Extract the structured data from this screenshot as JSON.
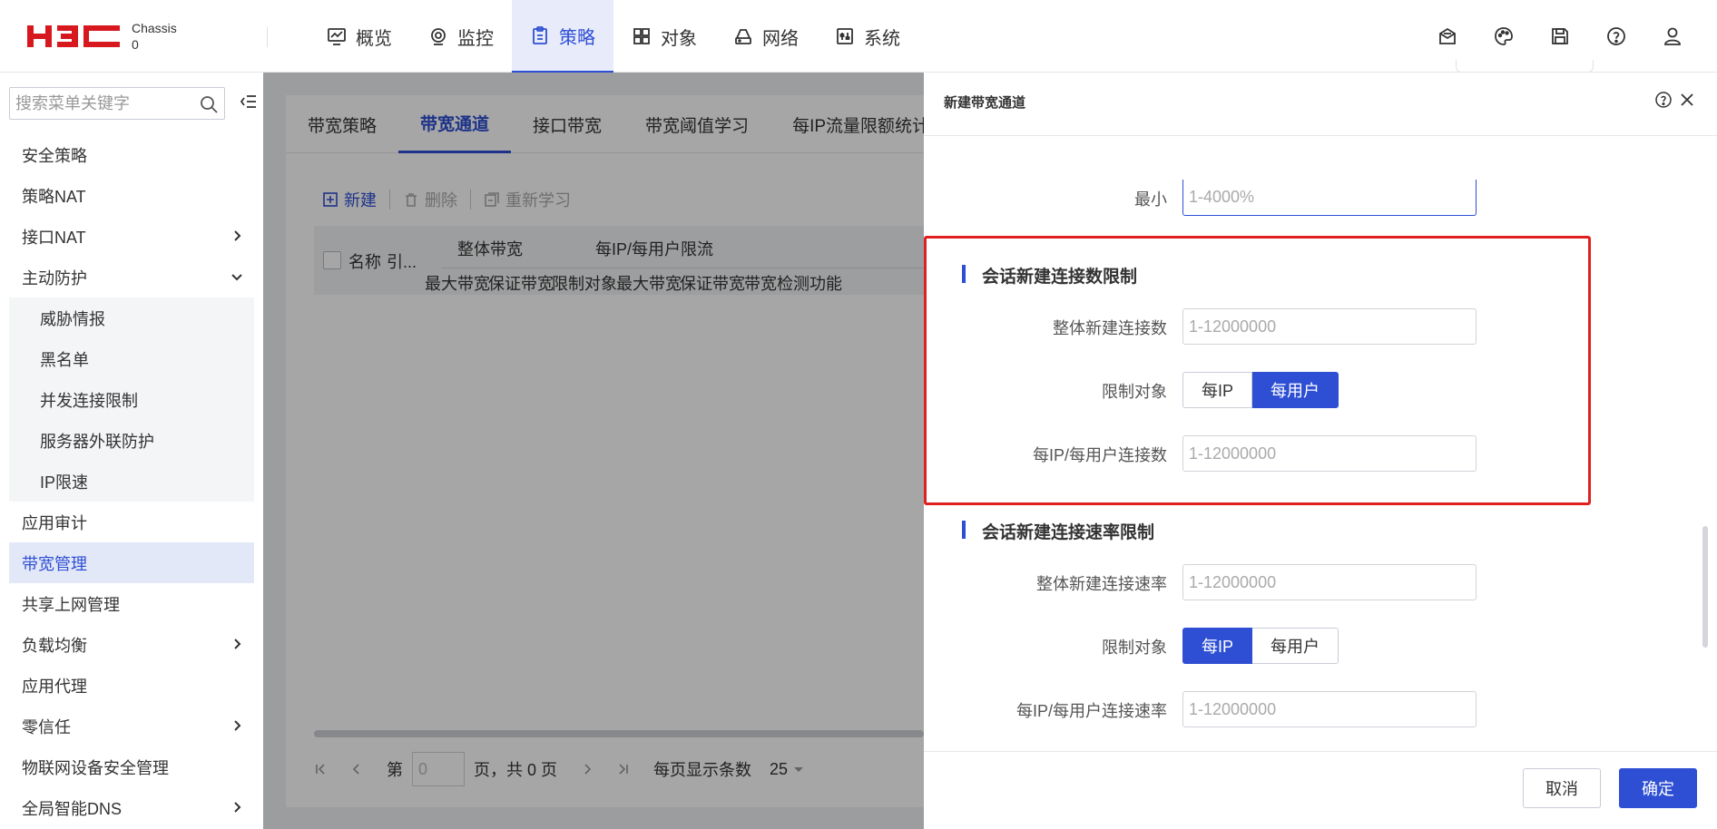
{
  "app": {
    "brand": "H3C",
    "chassis_label": "Chassis",
    "chassis_value": "0",
    "colors": {
      "accent": "#2e4fd3",
      "highlight_border": "#e02020",
      "brand_red": "#d7191f"
    }
  },
  "nav": {
    "items": [
      {
        "label": "概览",
        "icon": "dashboard-icon"
      },
      {
        "label": "监控",
        "icon": "monitor-icon"
      },
      {
        "label": "策略",
        "icon": "policy-icon",
        "active": true
      },
      {
        "label": "对象",
        "icon": "object-grid-icon"
      },
      {
        "label": "网络",
        "icon": "network-icon"
      },
      {
        "label": "系统",
        "icon": "system-icon"
      }
    ],
    "right_icons": [
      "message-icon",
      "palette-icon",
      "save-icon",
      "help-icon",
      "user-icon"
    ]
  },
  "sidebar": {
    "search_placeholder": "搜索菜单关键字",
    "items": [
      {
        "label": "安全策略"
      },
      {
        "label": "策略NAT"
      },
      {
        "label": "接口NAT",
        "arrow": "right"
      },
      {
        "label": "主动防护",
        "arrow": "down"
      },
      {
        "label": "威胁情报",
        "sub": true
      },
      {
        "label": "黑名单",
        "sub": true
      },
      {
        "label": "并发连接限制",
        "sub": true
      },
      {
        "label": "服务器外联防护",
        "sub": true
      },
      {
        "label": "IP限速",
        "sub": true
      },
      {
        "label": "应用审计"
      },
      {
        "label": "带宽管理",
        "active": true
      },
      {
        "label": "共享上网管理"
      },
      {
        "label": "负载均衡",
        "arrow": "right"
      },
      {
        "label": "应用代理"
      },
      {
        "label": "零信任",
        "arrow": "right"
      },
      {
        "label": "物联网设备安全管理"
      },
      {
        "label": "全局智能DNS",
        "arrow": "right"
      }
    ]
  },
  "main": {
    "tabs": [
      "带宽策略",
      "带宽通道",
      "接口带宽",
      "带宽阈值学习",
      "每IP流量限额统计"
    ],
    "active_tab": 1,
    "toolbar": {
      "new": "新建",
      "delete": "删除",
      "relearn": "重新学习"
    },
    "table": {
      "col_name": "名称",
      "col_ref": "引...",
      "group_total": "整体带宽",
      "group_per": "每IP/每用户限流",
      "sub_max_bw": "最大带宽",
      "sub_guar_bw": "保证带宽",
      "sub_limit_obj": "限制对象",
      "sub_max_bw2": "最大带宽",
      "sub_guar_bw2": "保证带宽",
      "sub_detect": "带宽检测功能"
    },
    "pager": {
      "page_prefix": "第",
      "page_value": "0",
      "page_suffix": "页，共 0 页",
      "per_page_label": "每页显示条数",
      "per_page_value": "25"
    }
  },
  "drawer": {
    "title": "新建带宽通道",
    "min_label": "最小",
    "min_placeholder": "1-4000%",
    "section1": {
      "title": "会话新建连接数限制",
      "total_label": "整体新建连接数",
      "total_placeholder": "1-12000000",
      "limit_label": "限制对象",
      "opt_ip": "每IP",
      "opt_user": "每用户",
      "selected": "每用户",
      "per_label": "每IP/每用户连接数",
      "per_placeholder": "1-12000000"
    },
    "section2": {
      "title": "会话新建连接速率限制",
      "total_label": "整体新建连接速率",
      "total_placeholder": "1-12000000",
      "limit_label": "限制对象",
      "opt_ip": "每IP",
      "opt_user": "每用户",
      "selected": "每IP",
      "per_label": "每IP/每用户连接速率",
      "per_placeholder": "1-12000000"
    },
    "buttons": {
      "cancel": "取消",
      "ok": "确定"
    }
  }
}
